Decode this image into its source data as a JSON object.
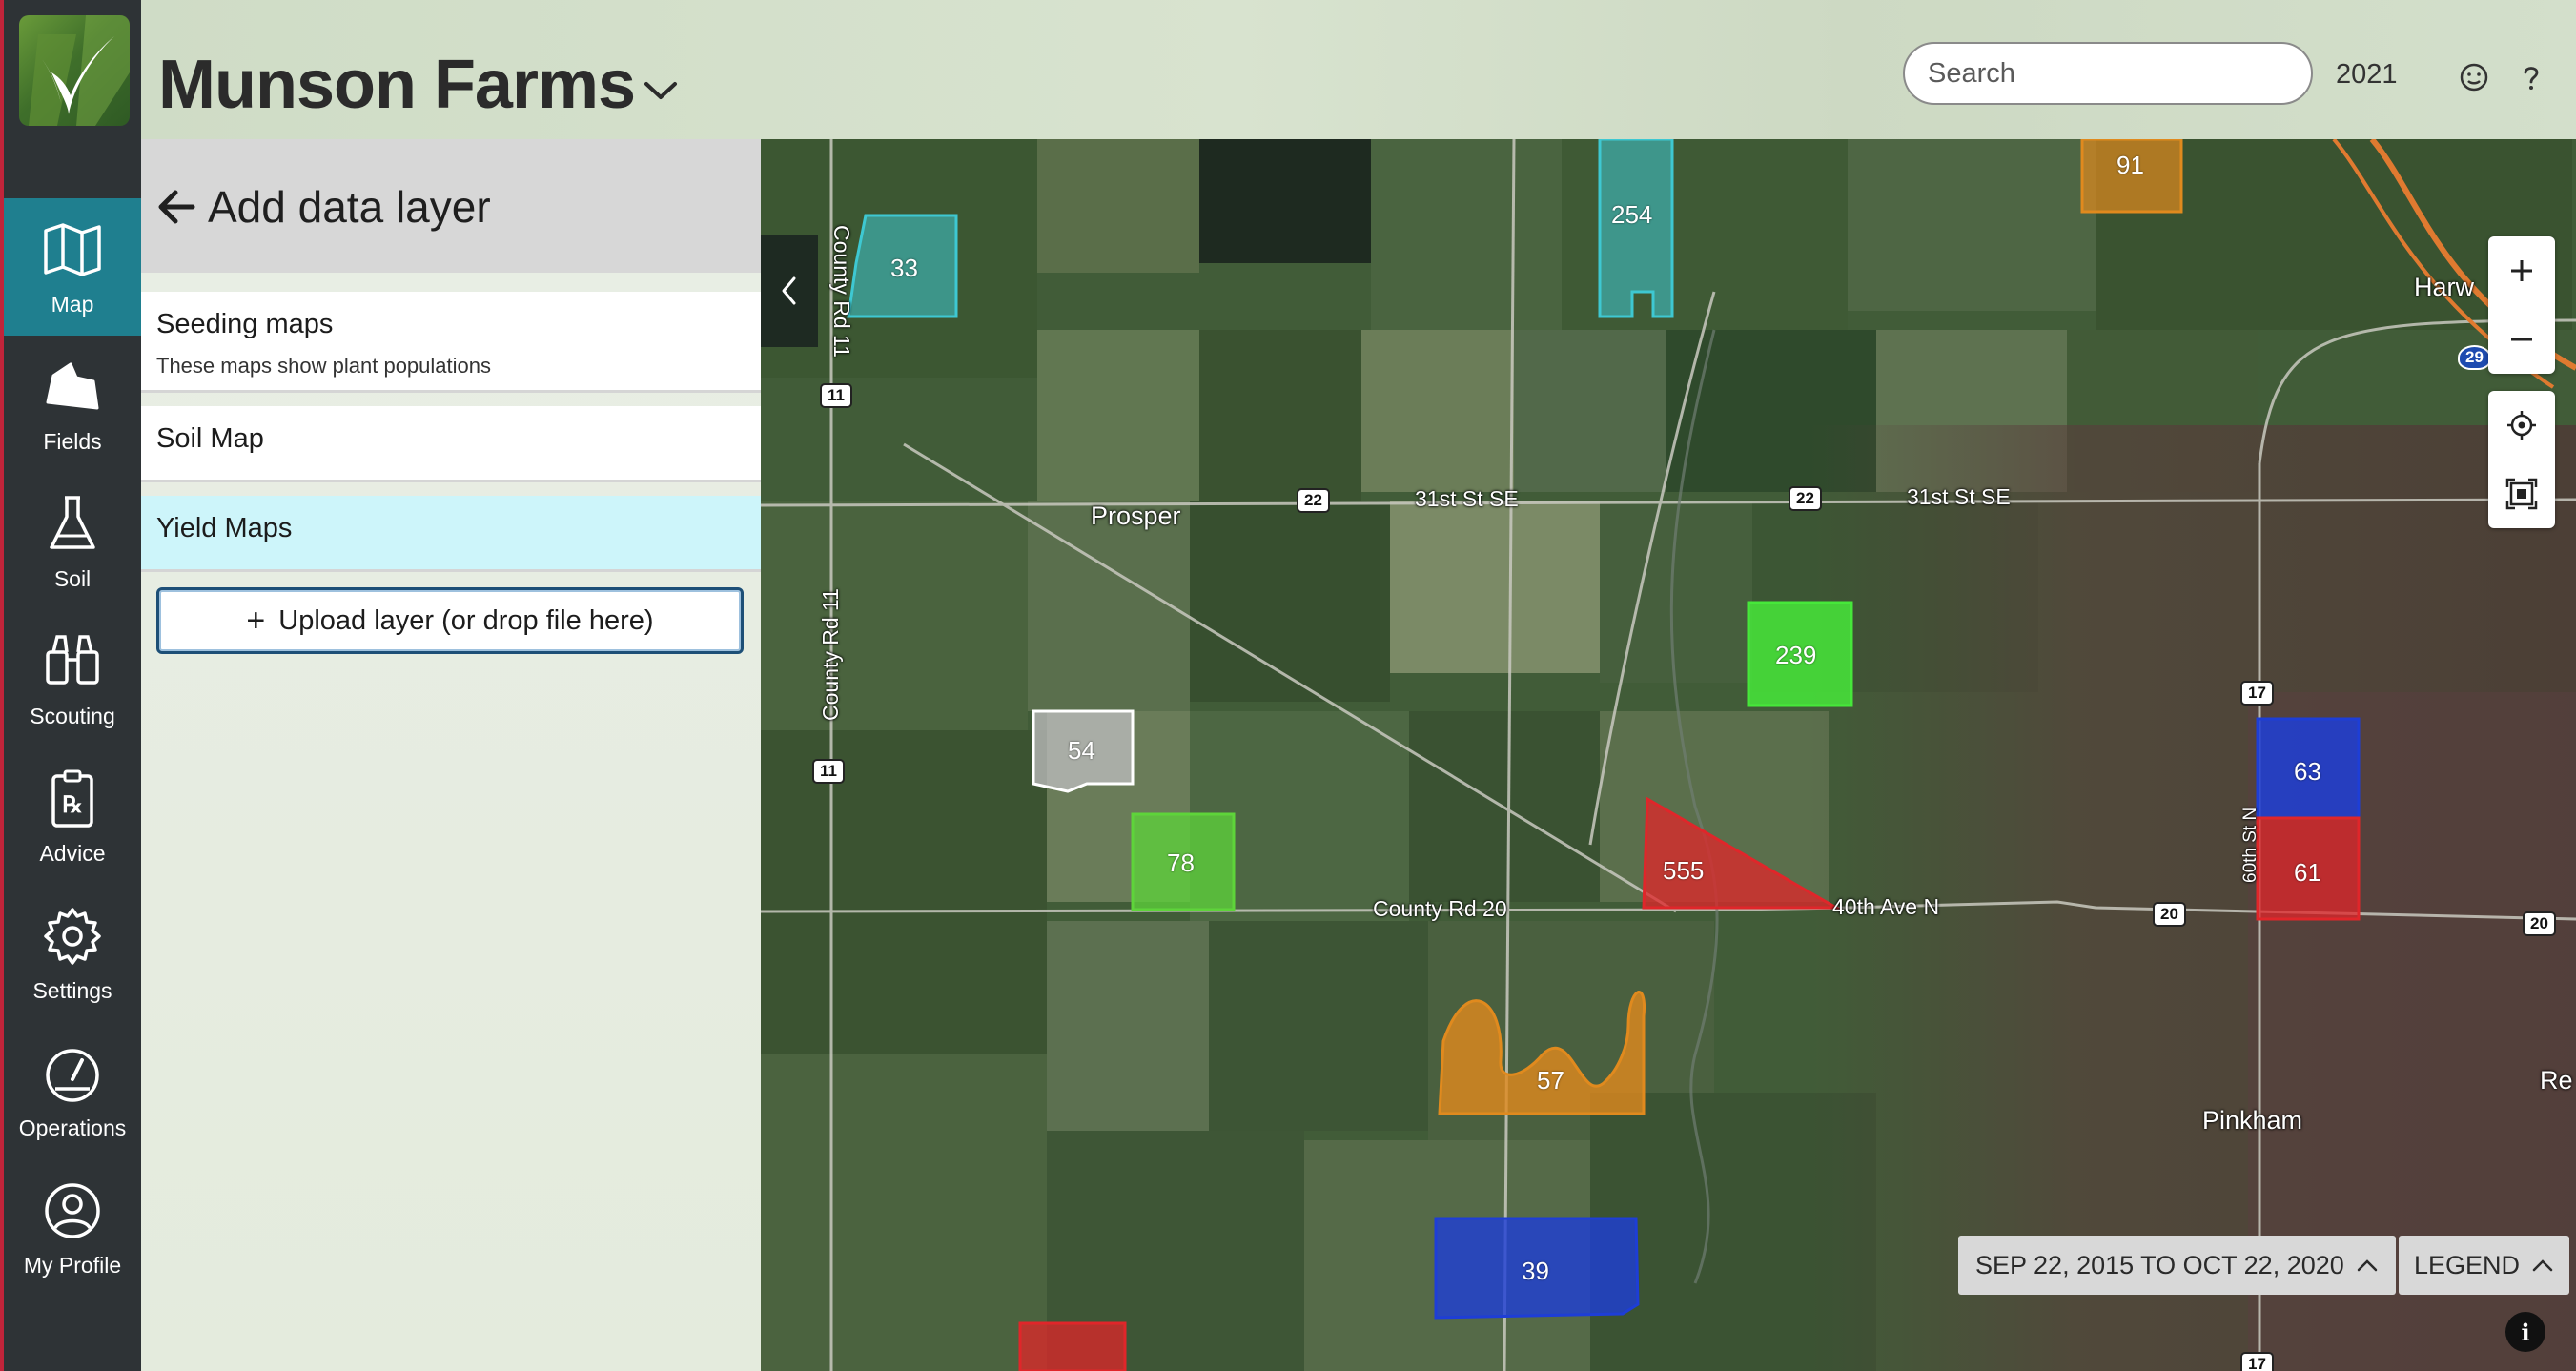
{
  "app": {
    "farm_name": "Munson Farms",
    "year": "2021"
  },
  "search": {
    "placeholder": "Search"
  },
  "nav": [
    {
      "label": "Map",
      "icon": "map-icon",
      "active": true
    },
    {
      "label": "Fields",
      "icon": "field-shape-icon"
    },
    {
      "label": "Soil",
      "icon": "flask-icon"
    },
    {
      "label": "Scouting",
      "icon": "binoculars-icon"
    },
    {
      "label": "Advice",
      "icon": "prescription-clipboard-icon"
    },
    {
      "label": "Settings",
      "icon": "gear-icon"
    },
    {
      "label": "Operations",
      "icon": "gauge-icon"
    },
    {
      "label": "My Profile",
      "icon": "user-circle-icon"
    }
  ],
  "panel": {
    "title": "Add data layer",
    "layers": [
      {
        "name": "Seeding maps",
        "description": "These maps show plant populations"
      },
      {
        "name": "Soil Map"
      },
      {
        "name": "Yield Maps",
        "selected": true
      }
    ],
    "upload_label": "Upload layer (or drop file here)"
  },
  "map": {
    "fields": [
      {
        "label": "33",
        "color": "#3ec8d2"
      },
      {
        "label": "254",
        "color": "#3ec8d2"
      },
      {
        "label": "91",
        "color": "#e08a1e"
      },
      {
        "label": "239",
        "color": "#46e83a"
      },
      {
        "label": "54",
        "color": "#b9b9b9"
      },
      {
        "label": "78",
        "color": "#5ed43a"
      },
      {
        "label": "555",
        "color": "#e0262a"
      },
      {
        "label": "63",
        "color": "#1e3ed6"
      },
      {
        "label": "61",
        "color": "#e0262a"
      },
      {
        "label": "57",
        "color": "#e08a1e"
      },
      {
        "label": "39",
        "color": "#1e3ed6"
      }
    ],
    "places": {
      "prosper": "Prosper",
      "pinkham": "Pinkham",
      "harw": "Harw",
      "re": "Re"
    },
    "roads": {
      "county_rd_11_top": "County Rd 11",
      "county_rd_11": "County Rd 11",
      "st31_a": "31st St SE",
      "st31_b": "31st St SE",
      "county_rd_20": "County Rd 20",
      "ave40": "40th Ave N",
      "st60": "60th St N"
    },
    "shields": {
      "s11a": "11",
      "s11b": "11",
      "s22a": "22",
      "s22b": "22",
      "s17a": "17",
      "s20a": "20",
      "s20b": "20",
      "s29": "29",
      "s17b": "17"
    },
    "date_range": "SEP 22, 2015 TO OCT 22, 2020",
    "legend_label": "LEGEND",
    "info_glyph": "i"
  },
  "colors": {
    "rail": "#2e3336",
    "active_nav": "#1f7f8f",
    "selected_layer": "#cdf5fa"
  }
}
